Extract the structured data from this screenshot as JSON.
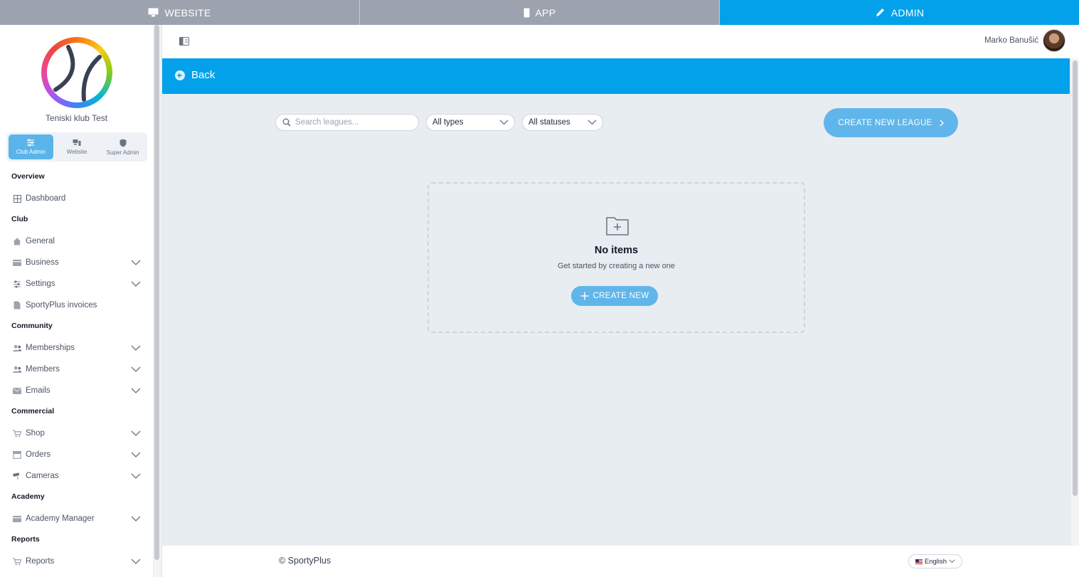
{
  "topbar": {
    "modes": [
      {
        "label": "WEBSITE",
        "icon": "monitor-icon",
        "active": false
      },
      {
        "label": "APP",
        "icon": "mobile-icon",
        "active": false
      },
      {
        "label": "ADMIN",
        "icon": "pen-icon",
        "active": true
      }
    ]
  },
  "sidebar": {
    "club_name": "Teniski klub Test",
    "roles": [
      {
        "label": "Club Admin",
        "icon": "sliders-icon",
        "active": true
      },
      {
        "label": "Website",
        "icon": "website-icon",
        "active": false
      },
      {
        "label": "Super Admin",
        "icon": "shield-icon",
        "active": false
      }
    ],
    "sections": [
      {
        "title": "Overview",
        "items": [
          {
            "label": "Dashboard",
            "icon": "dashboard-icon",
            "expandable": false
          }
        ]
      },
      {
        "title": "Club",
        "items": [
          {
            "label": "General",
            "icon": "home-icon",
            "expandable": false
          },
          {
            "label": "Business",
            "icon": "card-icon",
            "expandable": true
          },
          {
            "label": "Settings",
            "icon": "sliders-icon",
            "expandable": true
          },
          {
            "label": "SportyPlus invoices",
            "icon": "document-icon",
            "expandable": false
          }
        ]
      },
      {
        "title": "Community",
        "items": [
          {
            "label": "Memberships",
            "icon": "users-icon",
            "expandable": true
          },
          {
            "label": "Members",
            "icon": "users-icon",
            "expandable": true
          },
          {
            "label": "Emails",
            "icon": "mail-icon",
            "expandable": true
          }
        ]
      },
      {
        "title": "Commercial",
        "items": [
          {
            "label": "Shop",
            "icon": "cart-icon",
            "expandable": true
          },
          {
            "label": "Orders",
            "icon": "box-icon",
            "expandable": true
          },
          {
            "label": "Cameras",
            "icon": "camera-icon",
            "expandable": true
          }
        ]
      },
      {
        "title": "Academy",
        "items": [
          {
            "label": "Academy Manager",
            "icon": "card-icon",
            "expandable": true
          }
        ]
      },
      {
        "title": "Reports",
        "items": [
          {
            "label": "Reports",
            "icon": "cart-icon",
            "expandable": true
          }
        ]
      }
    ]
  },
  "header": {
    "user_name": "Marko Banušić"
  },
  "backbar": {
    "back_label": "Back"
  },
  "filters": {
    "search_placeholder": "Search leagues...",
    "type_value": "All types",
    "status_value": "All statuses",
    "create_label": "CREATE NEW LEAGUE"
  },
  "empty_state": {
    "title": "No items",
    "subtitle": "Get started by creating a new one",
    "button_label": "CREATE NEW"
  },
  "footer": {
    "copyright": "© SportyPlus",
    "language": "English"
  },
  "colors": {
    "accent": "#03a1ea",
    "button": "#60b6ea",
    "inactive_mode": "#9ca3af",
    "background": "#e8edf2"
  }
}
